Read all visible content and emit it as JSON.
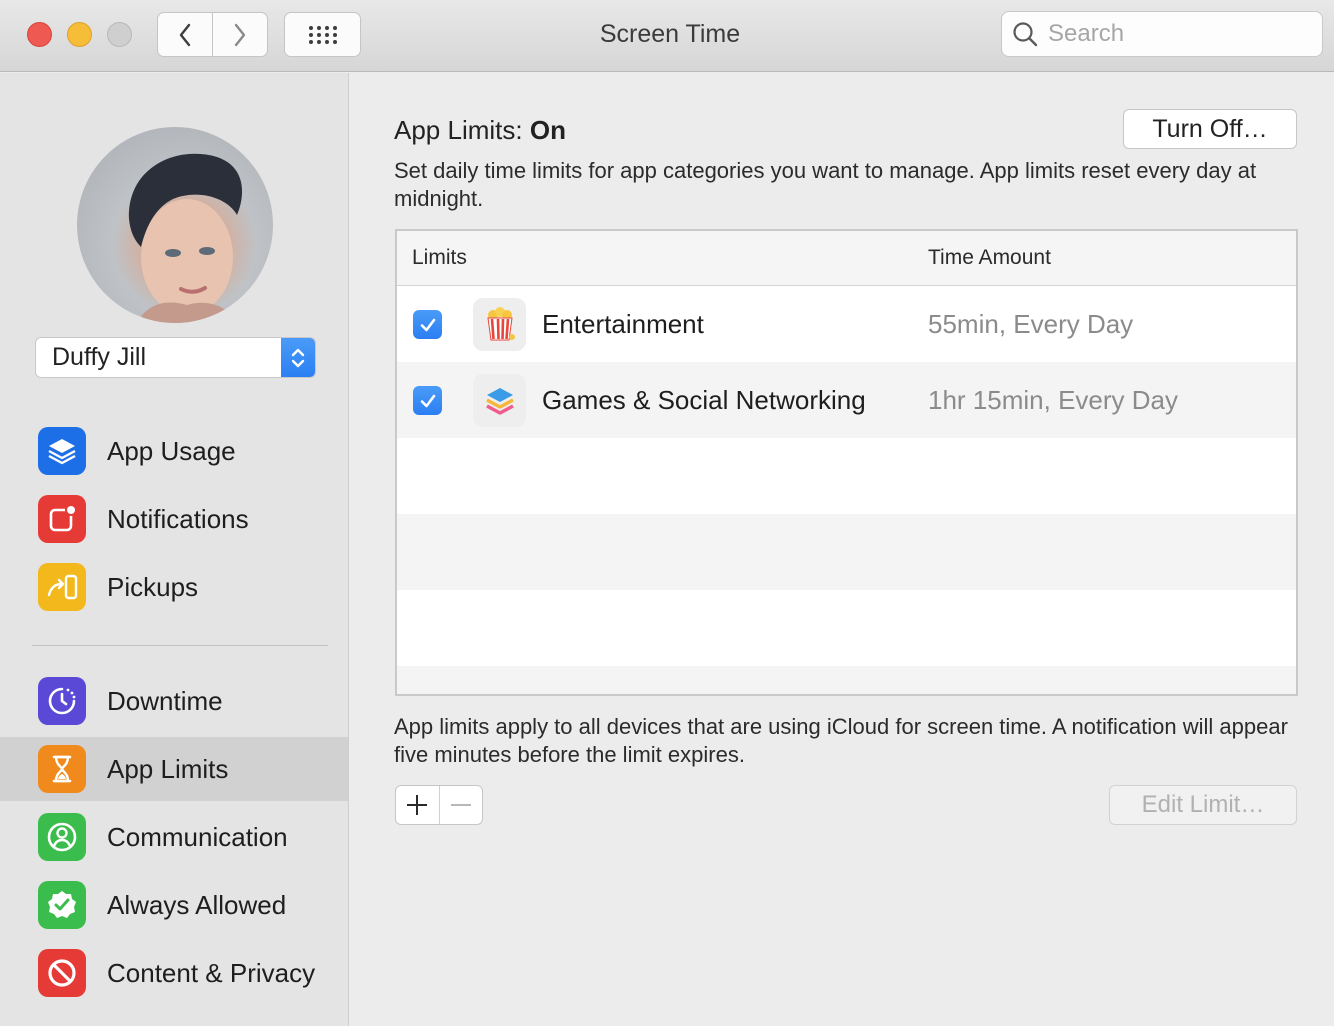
{
  "window": {
    "title": "Screen Time",
    "search_placeholder": "Search"
  },
  "user": {
    "name": "Duffy Jill"
  },
  "sidebar": {
    "group1": [
      {
        "label": "App Usage",
        "icon": "layers-icon",
        "color": "#1d6fe8"
      },
      {
        "label": "Notifications",
        "icon": "notification-icon",
        "color": "#e53a36"
      },
      {
        "label": "Pickups",
        "icon": "pickup-icon",
        "color": "#f2b81c"
      }
    ],
    "group2": [
      {
        "label": "Downtime",
        "icon": "downtime-icon",
        "color": "#5a48d6"
      },
      {
        "label": "App Limits",
        "icon": "hourglass-icon",
        "color": "#f08a1c",
        "selected": true
      },
      {
        "label": "Communication",
        "icon": "person-circle-icon",
        "color": "#3bbd4d"
      },
      {
        "label": "Always Allowed",
        "icon": "checkmark-badge-icon",
        "color": "#3bbd4d"
      },
      {
        "label": "Content & Privacy",
        "icon": "prohibited-icon",
        "color": "#e53a36"
      }
    ]
  },
  "main": {
    "heading_prefix": "App Limits:",
    "heading_status": "On",
    "turn_off_label": "Turn Off…",
    "description": "Set daily time limits for app categories you want to manage. App limits reset every day at midnight.",
    "table": {
      "headers": [
        "Limits",
        "Time Amount"
      ],
      "rows": [
        {
          "checked": true,
          "icon": "popcorn-icon",
          "name": "Entertainment",
          "time": "55min, Every Day"
        },
        {
          "checked": true,
          "icon": "stack-icon",
          "name": "Games & Social Networking",
          "time": "1hr 15min, Every Day"
        }
      ]
    },
    "footnote": "App limits apply to all devices that are using iCloud for screen time. A notification will appear five minutes before the limit expires.",
    "edit_limit_label": "Edit Limit…"
  }
}
